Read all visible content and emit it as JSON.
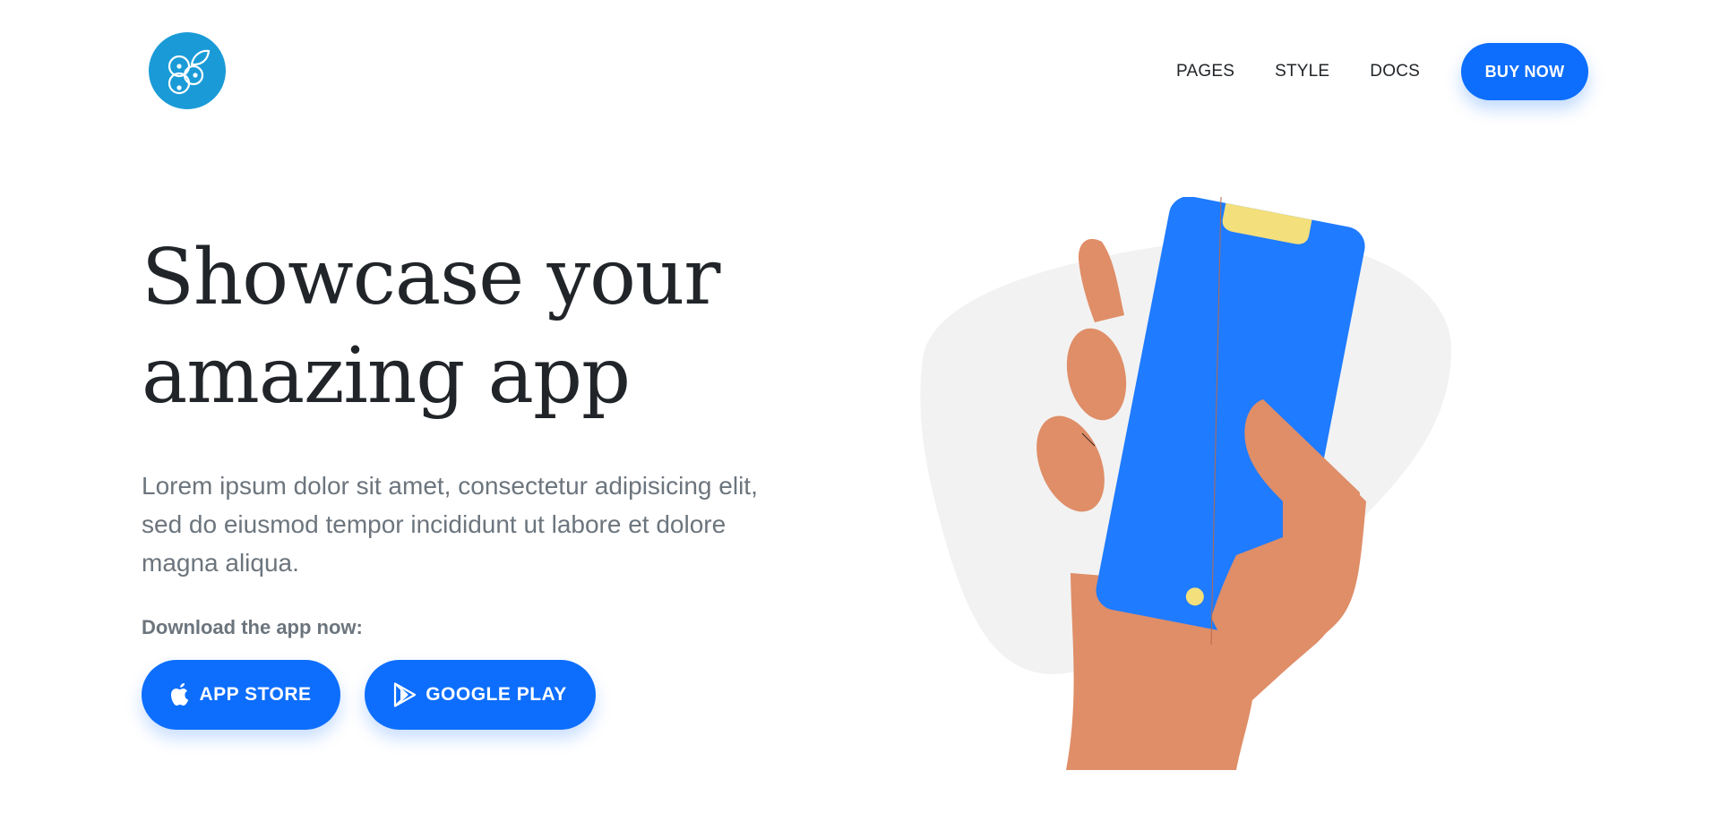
{
  "nav": {
    "links": [
      "PAGES",
      "STYLE",
      "DOCS"
    ],
    "cta": "BUY NOW"
  },
  "hero": {
    "headline_line1": "Showcase your",
    "headline_line2": "amazing app",
    "lead_line1": "Lorem ipsum dolor sit amet, consectetur adipisicing elit,",
    "lead_line2": "sed do eiusmod tempor incididunt ut labore et dolore",
    "lead_line3": "magna aliqua.",
    "download_label": "Download the app now:",
    "app_store": "APP STORE",
    "google_play": "GOOGLE PLAY"
  },
  "colors": {
    "primary": "#0d6efd",
    "logo": "#1a9bd7",
    "phone": "#1f7bff",
    "skin": "#df8e68",
    "accent_yellow": "#f3df7c",
    "blob": "#f2f2f2"
  },
  "icons": [
    "blueberry-logo-icon",
    "apple-icon",
    "google-play-icon"
  ]
}
